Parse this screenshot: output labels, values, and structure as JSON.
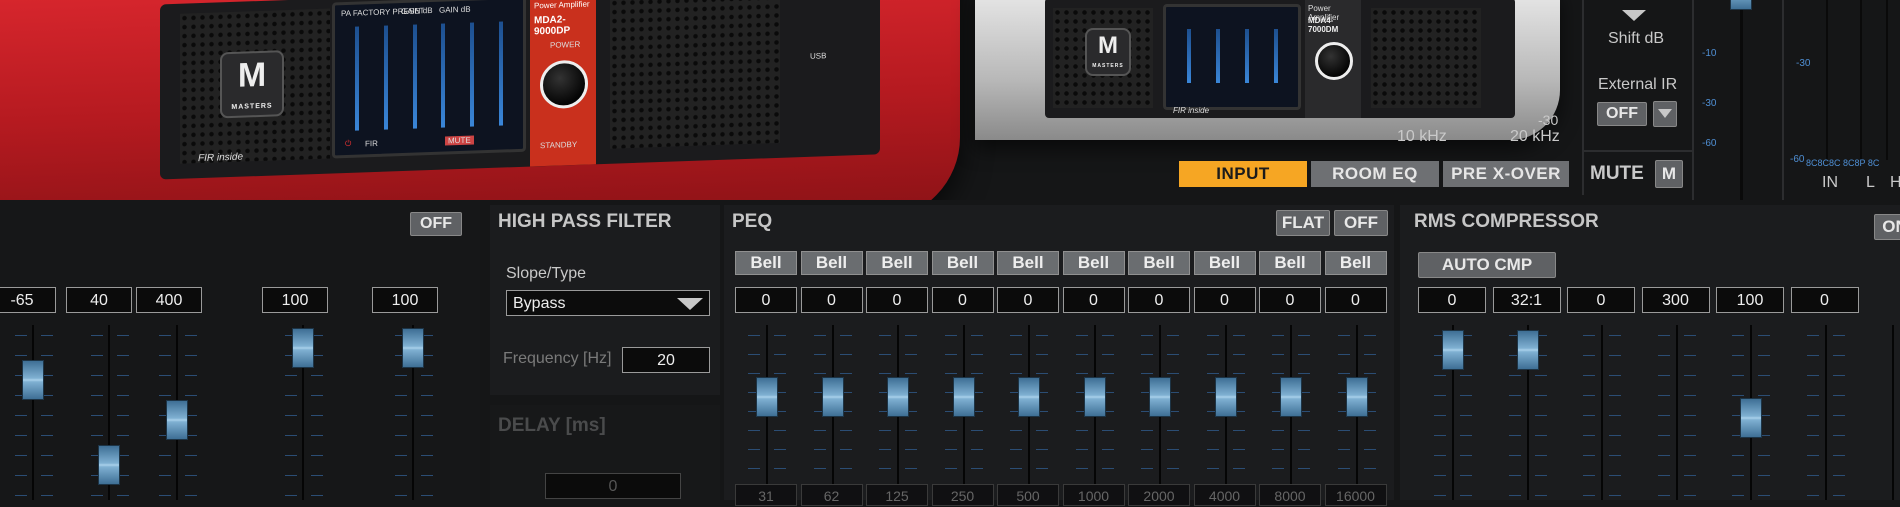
{
  "hero": {
    "red_unit": {
      "screen_header": "PA FACTORY PRESET",
      "screen_ch1": "GAIN dB",
      "screen_ch2": "GAIN dB",
      "screen_mute": "MUTE",
      "screen_fir": "FIR",
      "model_caption": "Power Amplifier",
      "model": "MDA2-9000DP",
      "power_label": "POWER",
      "standby_label": "STANDBY",
      "brand": "MASTERS",
      "logo_letter": "M",
      "fir_badge": "FIR inside",
      "usb_label": "USB"
    },
    "white_unit": {
      "model_caption": "Power Amplifier",
      "model": "MDA4-7000DM",
      "brand": "MASTERS",
      "logo_letter": "M",
      "fir_badge": "FIR inside"
    },
    "overlay": {
      "freq_10k": "10 kHz",
      "freq_20k": "20 kHz",
      "db_label": "-30"
    }
  },
  "right_strip": {
    "shift_label": "Shift dB",
    "external_ir_label": "External IR",
    "external_ir_value": "OFF",
    "mute_label": "MUTE",
    "mute_button": "M",
    "meter_scale": [
      "-10",
      "-30",
      "-60"
    ],
    "meter_scale_2": [
      "-30",
      "-60"
    ],
    "meter_labels": [
      "IN",
      "L",
      "H"
    ],
    "meter_bottom_digits": "8C8C8C 8C8P 8C"
  },
  "tabs": [
    {
      "label": "INPUT",
      "active": true
    },
    {
      "label": "ROOM EQ",
      "active": false
    },
    {
      "label": "PRE X-OVER",
      "active": false
    }
  ],
  "colors": {
    "accent": "#f6a623",
    "tab_inactive": "#6e7073",
    "thumb": "#7fb0d2"
  },
  "left_section": {
    "toggle": "OFF",
    "values": [
      "-65",
      "40",
      "400",
      "100",
      "100"
    ]
  },
  "hpf": {
    "title": "HIGH PASS FILTER",
    "slope_label": "Slope/Type",
    "slope_value": "Bypass",
    "freq_label": "Frequency [Hz]",
    "freq_value": "20",
    "delay_title": "DELAY [ms]",
    "delay_value": "0"
  },
  "peq": {
    "title": "PEQ",
    "flat_button": "FLAT",
    "off_button": "OFF",
    "bands": [
      {
        "type": "Bell",
        "gain": "0",
        "freq": "31"
      },
      {
        "type": "Bell",
        "gain": "0",
        "freq": "62"
      },
      {
        "type": "Bell",
        "gain": "0",
        "freq": "125"
      },
      {
        "type": "Bell",
        "gain": "0",
        "freq": "250"
      },
      {
        "type": "Bell",
        "gain": "0",
        "freq": "500"
      },
      {
        "type": "Bell",
        "gain": "0",
        "freq": "1000"
      },
      {
        "type": "Bell",
        "gain": "0",
        "freq": "2000"
      },
      {
        "type": "Bell",
        "gain": "0",
        "freq": "4000"
      },
      {
        "type": "Bell",
        "gain": "0",
        "freq": "8000"
      },
      {
        "type": "Bell",
        "gain": "0",
        "freq": "16000"
      }
    ]
  },
  "rms": {
    "title": "RMS COMPRESSOR",
    "auto_button": "AUTO CMP",
    "right_button": "ON",
    "values": [
      "0",
      "32:1",
      "0",
      "300",
      "100",
      "0"
    ]
  }
}
